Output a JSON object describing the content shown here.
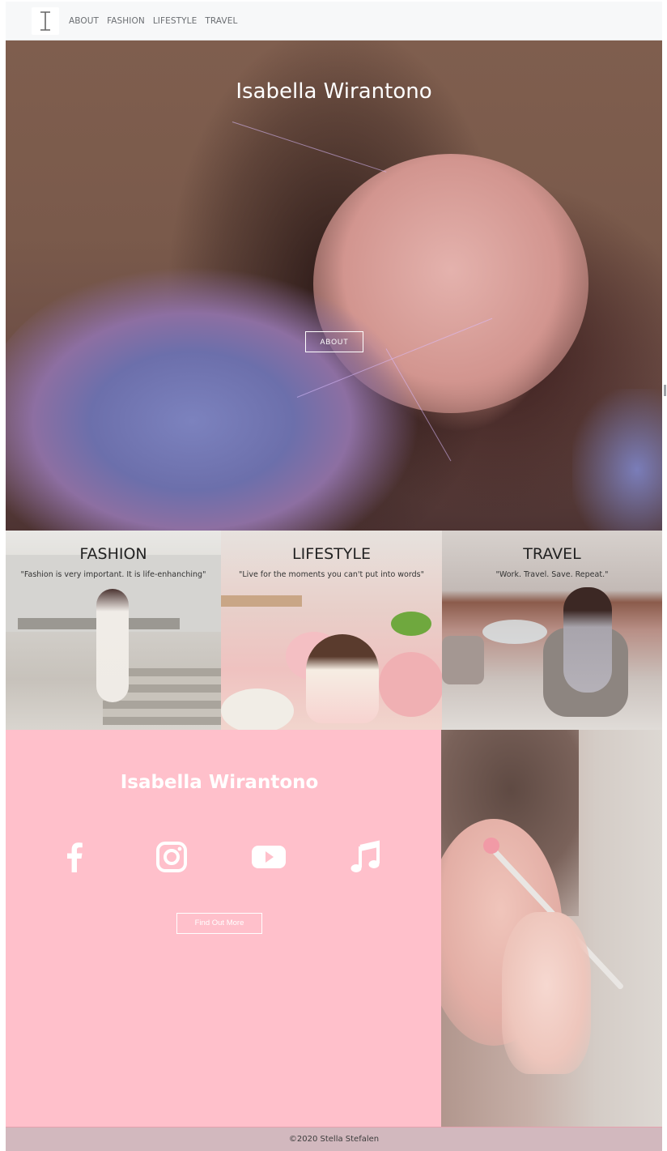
{
  "nav": {
    "logo_icon": "text-cursor-icon",
    "links": [
      "ABOUT",
      "FASHION",
      "LIFESTYLE",
      "TRAVEL"
    ]
  },
  "hero": {
    "title": "Isabella Wirantono",
    "button_label": "ABOUT"
  },
  "categories": [
    {
      "title": "FASHION",
      "quote": "\"Fashion is very important. It is life-enhanching\""
    },
    {
      "title": "LIFESTYLE",
      "quote": "\"Live for the moments you can't put into words\""
    },
    {
      "title": "TRAVEL",
      "quote": "\"Work. Travel. Save. Repeat.\""
    }
  ],
  "promo": {
    "title": "Isabella Wirantono",
    "social_icons": [
      "facebook-icon",
      "instagram-icon",
      "youtube-icon",
      "music-note-icon"
    ],
    "button_label": "Find Out More",
    "background_color": "#ffc0cb"
  },
  "footer": {
    "text": "©2020 Stella Stefalen"
  }
}
